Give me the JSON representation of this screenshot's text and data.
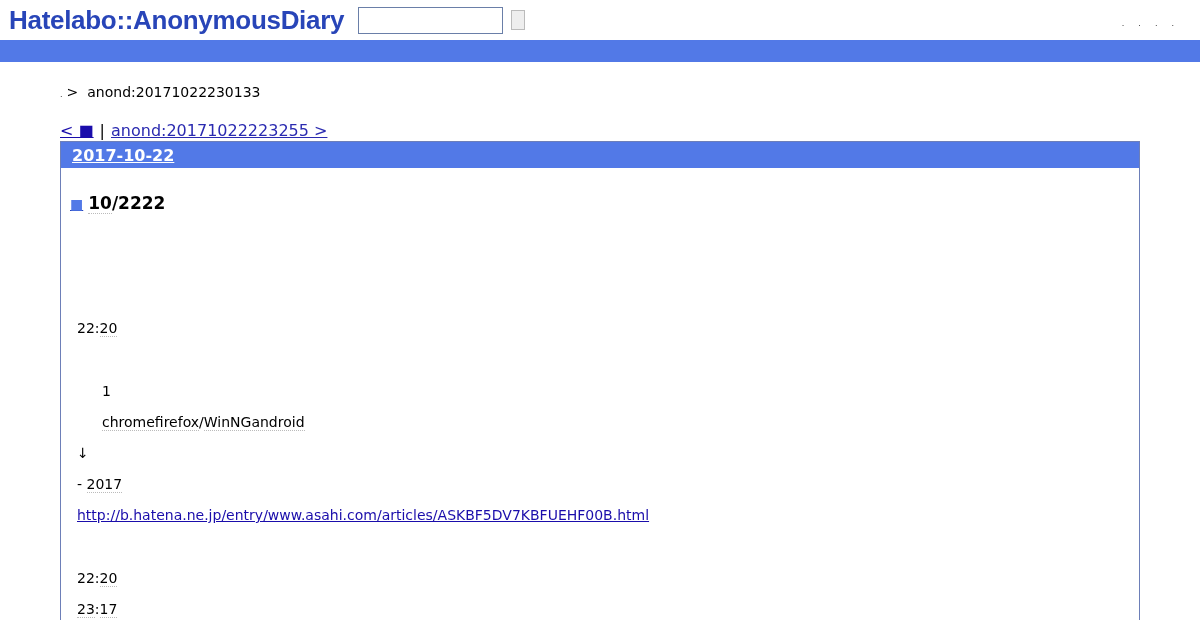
{
  "header": {
    "logo": "Hatelabo::AnonymousDiary",
    "nav_marks": [
      ".",
      ".",
      ".",
      "."
    ]
  },
  "breadcrumb": {
    "home": ".",
    "separator": ">",
    "current": "anond:20171022230133"
  },
  "pager": {
    "prev": "< ■",
    "separator": "|",
    "next": "anond:20171022223255 >"
  },
  "day": {
    "date": "2017-10-22",
    "entry": {
      "marker": "■",
      "title": [
        {
          "text": "10",
          "keyword": true
        },
        {
          "text": "/2222",
          "keyword": false
        }
      ],
      "paragraphs": [
        {
          "kind": "blank"
        },
        {
          "kind": "text",
          "parts": [
            {
              "text": "22:",
              "keyword": false
            },
            {
              "text": "20",
              "keyword": true
            }
          ]
        },
        {
          "kind": "gap"
        },
        {
          "kind": "indented",
          "parts": [
            {
              "text": "1",
              "keyword": false
            }
          ]
        },
        {
          "kind": "indented",
          "parts": [
            {
              "text": "chromefirefox",
              "keyword": true
            },
            {
              "text": "/",
              "keyword": false
            },
            {
              "text": "WinNGandroid",
              "keyword": true
            }
          ]
        },
        {
          "kind": "text",
          "parts": [
            {
              "text": "↓",
              "keyword": false
            }
          ]
        },
        {
          "kind": "text",
          "parts": [
            {
              "text": " -  ",
              "keyword": false
            },
            {
              "text": "2017",
              "keyword": true
            }
          ]
        },
        {
          "kind": "link",
          "parts": [
            {
              "text": "http://b.hatena.ne.jp/entry/www.asahi.com/articles/ASKBF5DV7KBFUEHF00B.html",
              "keyword": false
            }
          ]
        },
        {
          "kind": "gap"
        },
        {
          "kind": "text",
          "parts": [
            {
              "text": "22:",
              "keyword": false
            },
            {
              "text": "20",
              "keyword": true
            }
          ]
        },
        {
          "kind": "text",
          "parts": [
            {
              "text": "23",
              "keyword": true
            },
            {
              "text": ":",
              "keyword": false
            },
            {
              "text": "17",
              "keyword": true
            }
          ]
        }
      ]
    }
  }
}
